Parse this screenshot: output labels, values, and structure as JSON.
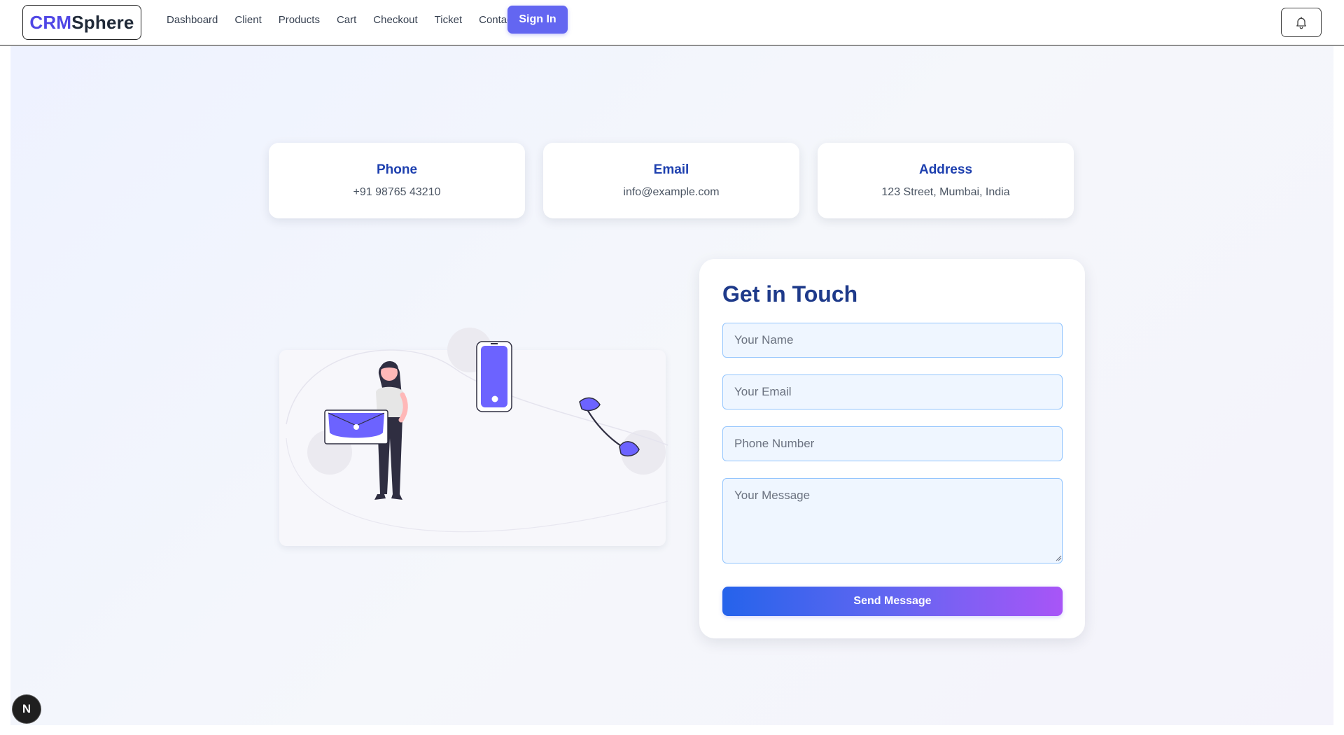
{
  "header": {
    "logo": {
      "part1": "CRM",
      "part2": "Sphere"
    },
    "nav": [
      {
        "label": "Dashboard"
      },
      {
        "label": "Client"
      },
      {
        "label": "Products"
      },
      {
        "label": "Cart"
      },
      {
        "label": "Checkout"
      },
      {
        "label": "Ticket"
      },
      {
        "label": "Contact"
      }
    ],
    "signin_label": "Sign In",
    "bell_icon": "bell-icon"
  },
  "contact_info": [
    {
      "title": "Phone",
      "value": "+91 98765 43210"
    },
    {
      "title": "Email",
      "value": "info@example.com"
    },
    {
      "title": "Address",
      "value": "123 Street, Mumbai, India"
    }
  ],
  "form": {
    "title": "Get in Touch",
    "name_placeholder": "Your Name",
    "email_placeholder": "Your Email",
    "phone_placeholder": "Phone Number",
    "message_placeholder": "Your Message",
    "send_label": "Send Message"
  },
  "badge": {
    "label": "N"
  },
  "colors": {
    "brand": "#4f46e5",
    "accent": "#6366f1",
    "heading": "#1e3a8a",
    "gradient_start": "#2563eb",
    "gradient_end": "#a855f7"
  }
}
